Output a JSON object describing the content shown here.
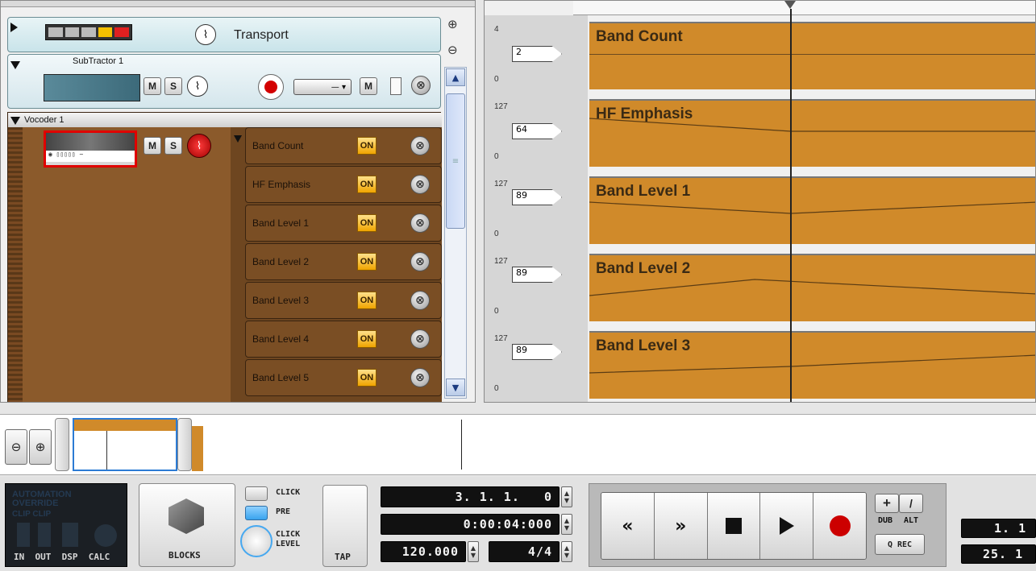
{
  "transport_track": {
    "label": "Transport"
  },
  "subtractor": {
    "name": "SubTractor 1",
    "mute": "M",
    "solo": "S",
    "mute2": "M"
  },
  "vocoder": {
    "name": "Vocoder 1",
    "mute": "M",
    "solo": "S"
  },
  "automation_lanes": [
    {
      "name": "Band Count",
      "on": "ON"
    },
    {
      "name": "HF Emphasis",
      "on": "ON"
    },
    {
      "name": "Band Level 1",
      "on": "ON"
    },
    {
      "name": "Band Level 2",
      "on": "ON"
    },
    {
      "name": "Band Level 3",
      "on": "ON"
    },
    {
      "name": "Band Level 4",
      "on": "ON"
    },
    {
      "name": "Band Level 5",
      "on": "ON"
    }
  ],
  "lane_scales": [
    {
      "max": "4",
      "min": "0",
      "value": "2",
      "clip": "Band Count"
    },
    {
      "max": "127",
      "min": "0",
      "value": "64",
      "clip": "HF Emphasis"
    },
    {
      "max": "127",
      "min": "0",
      "value": "89",
      "clip": "Band Level 1"
    },
    {
      "max": "127",
      "min": "0",
      "value": "89",
      "clip": "Band Level 2"
    },
    {
      "max": "127",
      "min": "0",
      "value": "89",
      "clip": "Band Level 3"
    }
  ],
  "meter": {
    "automation_override": "AUTOMATION OVERRIDE",
    "clip_labels": "CLIP CLIP",
    "labels": "IN  OUT  DSP  CALC"
  },
  "blocks": {
    "label": "BLOCKS"
  },
  "click": {
    "click": "CLICK",
    "pre": "PRE",
    "click_level_1": "CLICK",
    "click_level_2": "LEVEL",
    "tap": "TAP"
  },
  "position": {
    "bars": "3. 1. 1.   0",
    "time": "0:00:04:000",
    "tempo": "120.000",
    "signature": "4/4"
  },
  "transport": {
    "dub": "DUB",
    "alt": "ALT",
    "qrec": "Q REC",
    "plus": "+",
    "slash": "/"
  },
  "right_readouts": {
    "top": "1. 1",
    "bottom": "25. 1"
  },
  "colors": {
    "lane_orange": "#d08a2a",
    "track_brown": "#8b5a2b",
    "record_red": "#cc0000"
  }
}
